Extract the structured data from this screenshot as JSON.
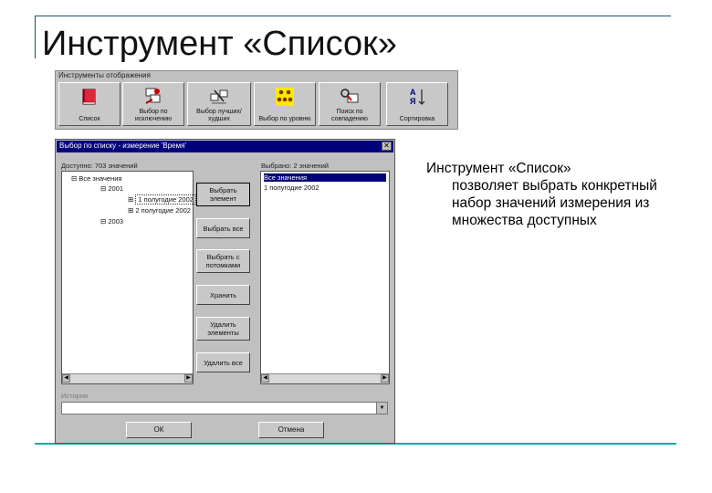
{
  "slide": {
    "title": "Инструмент «Список»",
    "description_first": "Инструмент «Список»",
    "description_rest": "позволяет выбрать конкретный набор значений измерения из множества доступных"
  },
  "toolbar": {
    "title": "Инструменты отображения",
    "buttons": [
      {
        "label": "Список",
        "icon": "list-book-icon"
      },
      {
        "label": "Выбор по исключению",
        "icon": "exclude-select-icon"
      },
      {
        "label": "Выбор лучших/худших",
        "icon": "best-worst-icon"
      },
      {
        "label": "Выбор по уровню",
        "icon": "level-select-icon"
      },
      {
        "label": "Поиск по совпадению",
        "icon": "match-search-icon"
      },
      {
        "label": "Сортировка",
        "icon": "sort-az-icon"
      }
    ]
  },
  "dialog": {
    "title": "Выбор по списку - измерение 'Время'",
    "available_caption": "Доступно: 703 значений",
    "selected_caption": "Выбрано: 2 значений",
    "tree": [
      "Все значения",
      "2001",
      "1 полугодие 2002",
      "2 полугодие 2002",
      "2003"
    ],
    "selected_list": [
      "Все значения",
      "1 полугодие 2002"
    ],
    "buttons": {
      "add": "Выбрать элемент",
      "add_all": "Выбрать все",
      "add_children": "Выбрать с потомками",
      "save": "Хранить",
      "remove": "Удалить элементы",
      "remove_all": "Удалить все"
    },
    "history_label": "История",
    "history_value": "",
    "ok": "ОК",
    "cancel": "Отмена"
  }
}
